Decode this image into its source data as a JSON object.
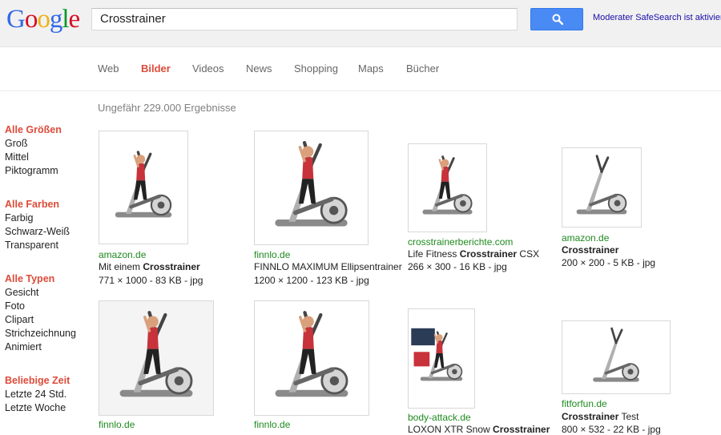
{
  "logo": {
    "letters": [
      "G",
      "o",
      "o",
      "g",
      "l",
      "e"
    ],
    "colors": [
      "#3369e8",
      "#d50f25",
      "#eeb211",
      "#3369e8",
      "#009925",
      "#d50f25"
    ]
  },
  "search": {
    "query": "Crosstrainer"
  },
  "safesearch": "Moderater SafeSearch ist aktiviert",
  "nav": {
    "tabs": [
      {
        "label": "Web"
      },
      {
        "label": "Bilder"
      },
      {
        "label": "Videos"
      },
      {
        "label": "News"
      },
      {
        "label": "Shopping"
      },
      {
        "label": "Maps"
      },
      {
        "label": "Bücher"
      }
    ],
    "active_index": 1
  },
  "result_stats": "Ungefähr 229.000 Ergebnisse",
  "sidebar": {
    "groups": [
      {
        "heading": "Alle Größen",
        "options": [
          "Groß",
          "Mittel",
          "Piktogramm"
        ]
      },
      {
        "heading": "Alle Farben",
        "options": [
          "Farbig",
          "Schwarz-Weiß",
          "Transparent"
        ]
      },
      {
        "heading": "Alle Typen",
        "options": [
          "Gesicht",
          "Foto",
          "Clipart",
          "Strichzeichnung",
          "Animiert"
        ]
      },
      {
        "heading": "Beliebige Zeit",
        "options": [
          "Letzte 24 Std.",
          "Letzte Woche"
        ]
      }
    ]
  },
  "results": [
    {
      "source": "amazon.de",
      "title_pre": "Mit einem ",
      "title_bold": "Crosstrainer",
      "title_post": "",
      "meta": "771 × 1000 - 83 KB - jpg"
    },
    {
      "source": "finnlo.de",
      "title_pre": "FINNLO MAXIMUM Ellipsentrainer",
      "title_bold": "",
      "title_post": "",
      "meta": "1200 × 1200 - 123 KB - jpg"
    },
    {
      "source": "crosstrainerberichte.com",
      "title_pre": "Life Fitness ",
      "title_bold": "Crosstrainer",
      "title_post": " CSX",
      "meta": "266 × 300 - 16 KB - jpg"
    },
    {
      "source": "amazon.de",
      "title_pre": "",
      "title_bold": "Crosstrainer",
      "title_post": "",
      "meta": "200 × 200 - 5 KB - jpg"
    },
    {
      "source": "finnlo.de",
      "title_pre": "",
      "title_bold": "",
      "title_post": "",
      "meta": ""
    },
    {
      "source": "finnlo.de",
      "title_pre": "",
      "title_bold": "",
      "title_post": "",
      "meta": ""
    },
    {
      "source": "body-attack.de",
      "title_pre": "LOXON XTR Snow ",
      "title_bold": "Crosstrainer",
      "title_post": "",
      "meta": ""
    },
    {
      "source": "fitforfun.de",
      "title_pre": "",
      "title_bold": "Crosstrainer",
      "title_post": " Test",
      "meta": "800 × 532 - 22 KB - jpg"
    }
  ]
}
